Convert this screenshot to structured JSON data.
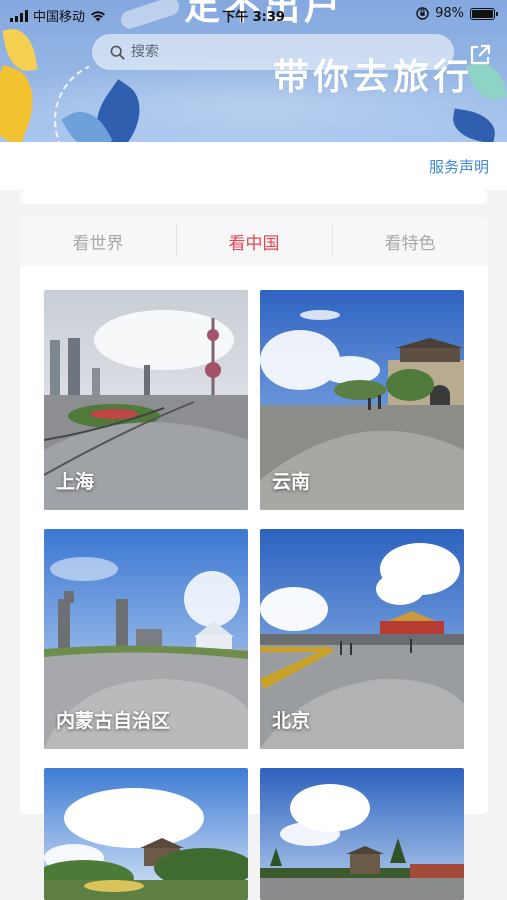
{
  "status_bar": {
    "carrier": "中国移动",
    "time": "下午 3:39",
    "battery_text": "98%",
    "battery_level": 0.98
  },
  "banner": {
    "slogan_top": "足不出户",
    "slogan": "带你去旅行"
  },
  "search": {
    "placeholder": "搜索"
  },
  "notice_link": "服务声明",
  "tabs": [
    {
      "label": "看世界",
      "active": false
    },
    {
      "label": "看中国",
      "active": true
    },
    {
      "label": "看特色",
      "active": false
    }
  ],
  "destinations": [
    {
      "name": "上海"
    },
    {
      "name": "云南"
    },
    {
      "name": "内蒙古自治区"
    },
    {
      "name": "北京"
    },
    {
      "name": ""
    },
    {
      "name": ""
    }
  ],
  "colors": {
    "accent_red": "#e0484e",
    "link_blue": "#3d8ad6",
    "banner_blue": "#84a8df"
  }
}
